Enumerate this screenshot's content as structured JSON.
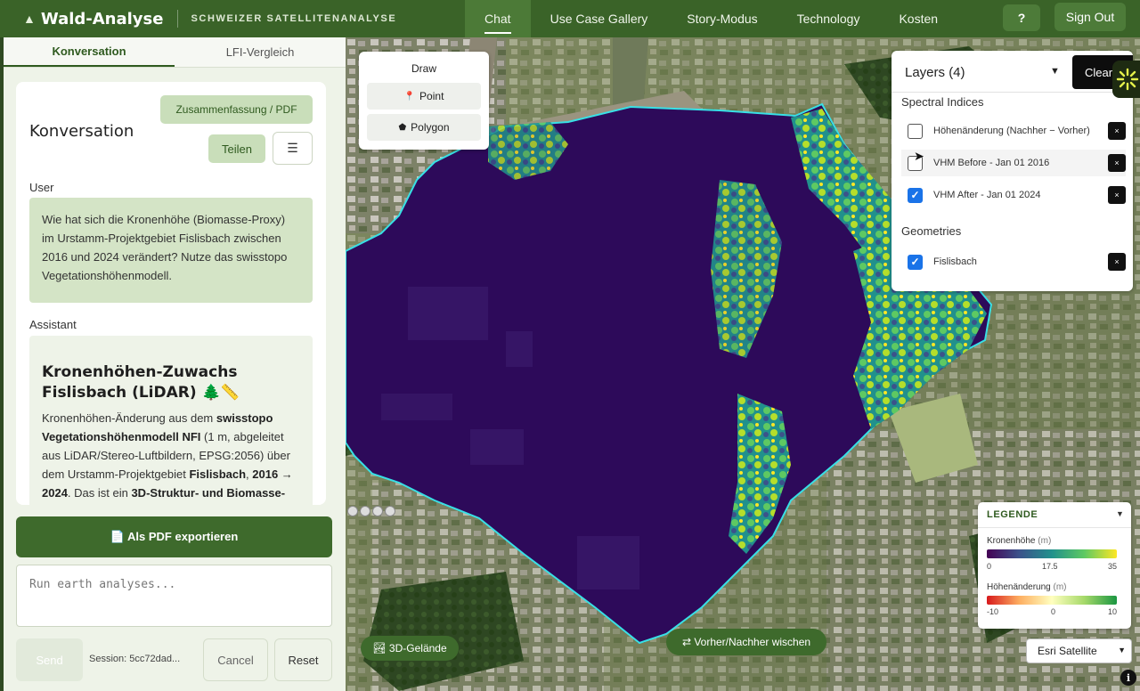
{
  "header": {
    "brand_icon": "tree-icon",
    "title": "Wald-Analyse",
    "subtitle": "SCHWEIZER SATELLITENANALYSE",
    "nav": [
      "Chat",
      "Use Case Gallery",
      "Story-Modus",
      "Technology",
      "Kosten"
    ],
    "help_label": "?",
    "signout_label": "Sign Out"
  },
  "tabs": [
    "Konversation",
    "LFI-Vergleich"
  ],
  "conversation": {
    "summary_label": "Zusammenfassung / PDF",
    "title": "Konversation",
    "share_label": "Teilen",
    "menu_icon": "hamburger-icon",
    "user_label": "User",
    "user_message": "Wie hat sich die Kronenhöhe (Biomasse-Proxy) im Urstamm-Projektgebiet Fislisbach zwischen 2016 und 2024 verändert? Nutze das swisstopo Vegetationshöhenmodell.",
    "assistant_label": "Assistant",
    "assistant_heading": "Kronenhöhen-Zuwachs Fislisbach (LiDAR) 🌲📏",
    "assistant_body": {
      "t1": "Kronenhöhen-Änderung aus dem ",
      "b1": "swisstopo Vegetationshöhenmodell NFI",
      "t2": " (1 m, abgeleitet aus LiDAR/Stereo-Luftbildern, EPSG:2056) über dem Urstamm-Projektgebiet ",
      "b2": "Fislisbach",
      "t3": ", ",
      "b3": "2016 → 2024",
      "t4": ". Das ist ein ",
      "b4": "3D-Struktur- und Biomasse-"
    }
  },
  "actions": {
    "pdf_label": "📄 Als PDF exportieren",
    "prompt_placeholder": "Run earth analyses...",
    "send_label": "Send",
    "session_label": "Session: 5cc72dad...",
    "cancel_label": "Cancel",
    "reset_label": "Reset"
  },
  "map": {
    "draw": {
      "title": "Draw",
      "point_label": "Point",
      "point_icon": "pin-icon",
      "polygon_label": "Polygon",
      "polygon_icon": "pentagon-icon"
    },
    "layers": {
      "title": "Layers (4)",
      "clear_label": "Clear",
      "spectral_label": "Spectral Indices",
      "items": [
        {
          "name": "Höhenänderung (Nachher − Vorher)",
          "checked": false
        },
        {
          "name": "VHM Before - Jan 01 2016",
          "checked": false
        },
        {
          "name": "VHM After - Jan 01 2024",
          "checked": true
        }
      ],
      "geometries_label": "Geometries",
      "geometry_items": [
        {
          "name": "Fislisbach",
          "checked": true
        }
      ],
      "remove_label": "×"
    },
    "legend": {
      "title": "LEGENDE",
      "canopy_label": "Kronenhöhe",
      "canopy_unit": "(m)",
      "canopy_ticks": [
        "0",
        "17.5",
        "35"
      ],
      "change_label": "Höhenänderung",
      "change_unit": "(m)",
      "change_ticks": [
        "-10",
        "0",
        "10"
      ]
    },
    "basemap_label": "Esri Satellite",
    "terrain_label": "🏞 3D-Gelände",
    "swipe_label": "⇄ Vorher/Nachher wischen",
    "info_label": "i",
    "colors": {
      "polygon_fill": "#2d0a5a",
      "outline": "#38e0e6",
      "accent_green": "#3e6a2c"
    }
  }
}
